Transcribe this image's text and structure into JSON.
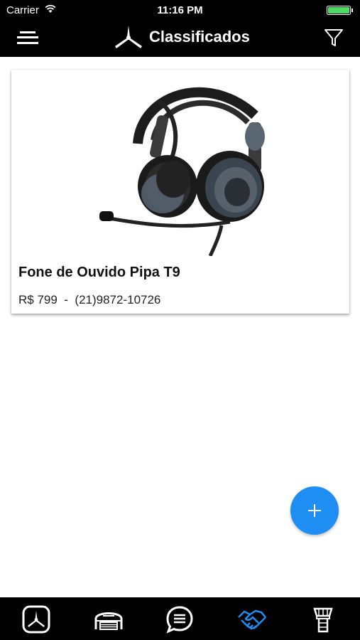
{
  "status_bar": {
    "carrier": "Carrier",
    "time": "11:16 PM"
  },
  "header": {
    "title": "Classificados"
  },
  "listing": {
    "title": "Fone de Ouvido Pipa T9",
    "price": "R$ 799",
    "separator": "-",
    "phone": "(21)9872-10726"
  },
  "tabs": [
    {
      "icon": "airplane-logo-icon"
    },
    {
      "icon": "hangar-icon"
    },
    {
      "icon": "chat-icon"
    },
    {
      "icon": "handshake-icon",
      "active": true
    },
    {
      "icon": "control-tower-icon"
    }
  ],
  "colors": {
    "accent": "#1e8ef2",
    "bar": "#000000",
    "active_tab": "#1e8ef2"
  }
}
